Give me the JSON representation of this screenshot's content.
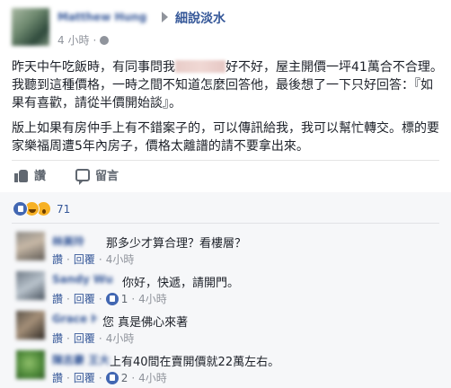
{
  "post": {
    "author": "Matthew Hung",
    "group": "細說淡水",
    "time": "4 小時",
    "paragraphs": [
      {
        "before": "昨天中午吃飯時，有同事問我",
        "redacted": "淡水新市鎮",
        "after": "好不好，屋主開價一坪41萬合不合理。我聽到這種價格，一時之間不知道怎麼回答他，最後想了一下只好回答：『如果有喜歡，請從半價開始談』。"
      },
      {
        "text": "版上如果有房仲手上有不錯案子的，可以傳訊給我，我可以幫忙轉交。標的要家樂福周遭5年內房子，價格太離譜的請不要拿出來。"
      }
    ]
  },
  "actions": {
    "like_label": "讚",
    "comment_label": "留言"
  },
  "reactions": {
    "count": "71"
  },
  "comments": [
    {
      "name": "林美玲",
      "text": "那多少才算合理？看樓層？",
      "like": "讚",
      "reply": "回覆",
      "time": "4小時",
      "likes": ""
    },
    {
      "name": "Sandy Wu",
      "text": "你好，快遞，請開門。",
      "like": "讚",
      "reply": "回覆",
      "time": "4小時",
      "likes": "1"
    },
    {
      "name": "Grace Hu",
      "text": "您 真是佛心來著",
      "like": "讚",
      "reply": "回覆",
      "time": "4小時",
      "likes": ""
    },
    {
      "name": "陳志豪 王大",
      "text": "上有40間在賣開價就22萬左右。",
      "like": "讚",
      "reply": "回覆",
      "time": "4小時",
      "likes": "2"
    }
  ],
  "colors": {
    "link": "#365899",
    "meta": "#90949c",
    "like_blue": "#4267b2"
  }
}
